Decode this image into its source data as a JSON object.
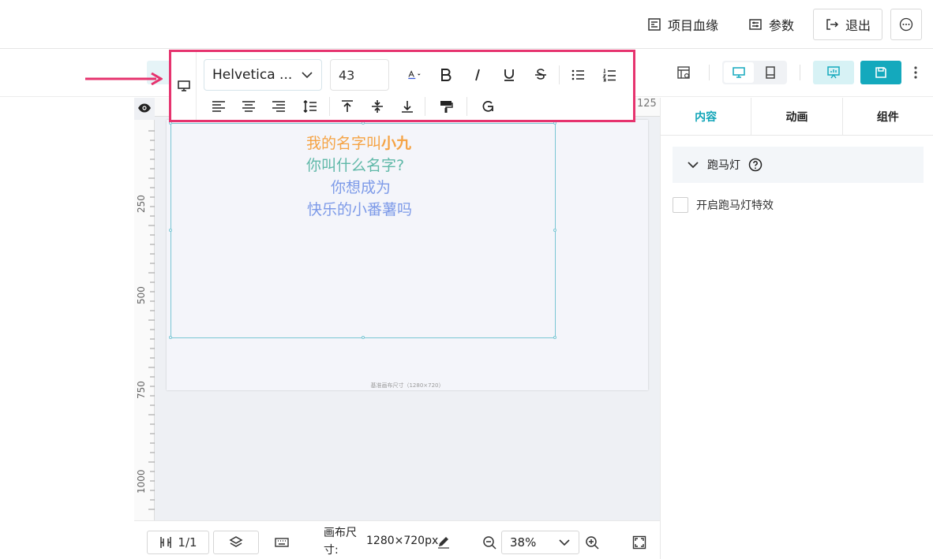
{
  "header": {
    "lineage_label": "项目血缘",
    "params_label": "参数",
    "exit_label": "退出"
  },
  "toolbar": {
    "font_family": "Helvetica ...",
    "font_size": "43"
  },
  "canvas": {
    "ruler_top_label": "125",
    "ruler_left_labels": [
      "250",
      "500",
      "750",
      "1000"
    ],
    "text_lines": [
      {
        "a": "我的名字叫",
        "b": "小九"
      },
      {
        "a": "你叫什么名字?"
      },
      {
        "a": "你想成为"
      },
      {
        "a": "快乐的小番薯吗"
      }
    ],
    "caption": "基准画布尺寸（1280×720）",
    "colors": {
      "line1": "#f5a344",
      "line2": "#5fb8a8",
      "line3": "#7d9ae8",
      "line4": "#7d9ae8"
    }
  },
  "panel": {
    "tabs": [
      "内容",
      "动画",
      "组件"
    ],
    "section_title": "跑马灯",
    "checkbox_label": "开启跑马灯特效"
  },
  "bottom": {
    "page_counter": "1/1",
    "canvas_size_label": "画布尺寸:",
    "canvas_size_value": "1280×720px",
    "zoom": "38%"
  },
  "colors": {
    "accent": "#14a9bd",
    "highlight_border": "#e6336e"
  }
}
